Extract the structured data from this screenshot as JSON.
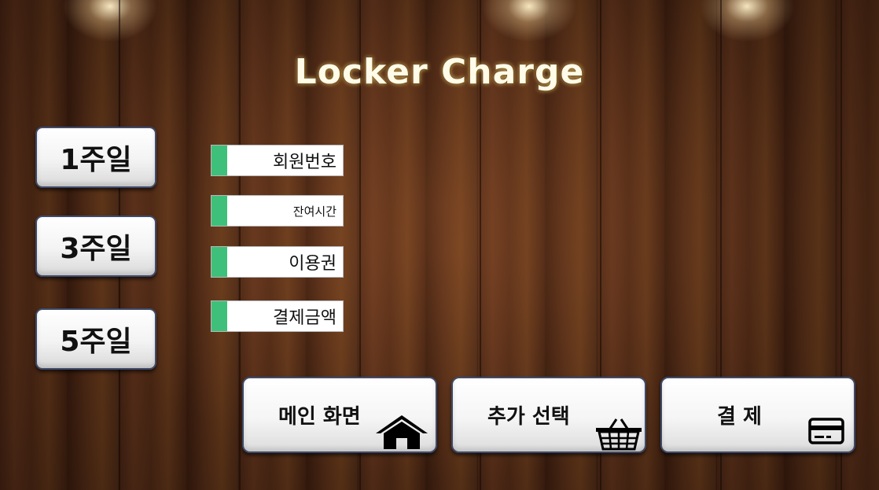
{
  "title": "Locker Charge",
  "durations": [
    {
      "label": "1주일"
    },
    {
      "label": "3주일"
    },
    {
      "label": "5주일"
    }
  ],
  "info_fields": [
    {
      "label": "회원번호"
    },
    {
      "label": "잔여시간"
    },
    {
      "label": "이용권"
    },
    {
      "label": "결제금액"
    }
  ],
  "actions": [
    {
      "label": "메인 화면",
      "icon": "home-icon"
    },
    {
      "label": "추가 선택",
      "icon": "basket-icon"
    },
    {
      "label": "결 제",
      "icon": "credit-card-icon"
    }
  ],
  "colors": {
    "field_accent": "#3ec07a",
    "button_border": "#3e4a6a",
    "title_text": "#fffbe8"
  }
}
